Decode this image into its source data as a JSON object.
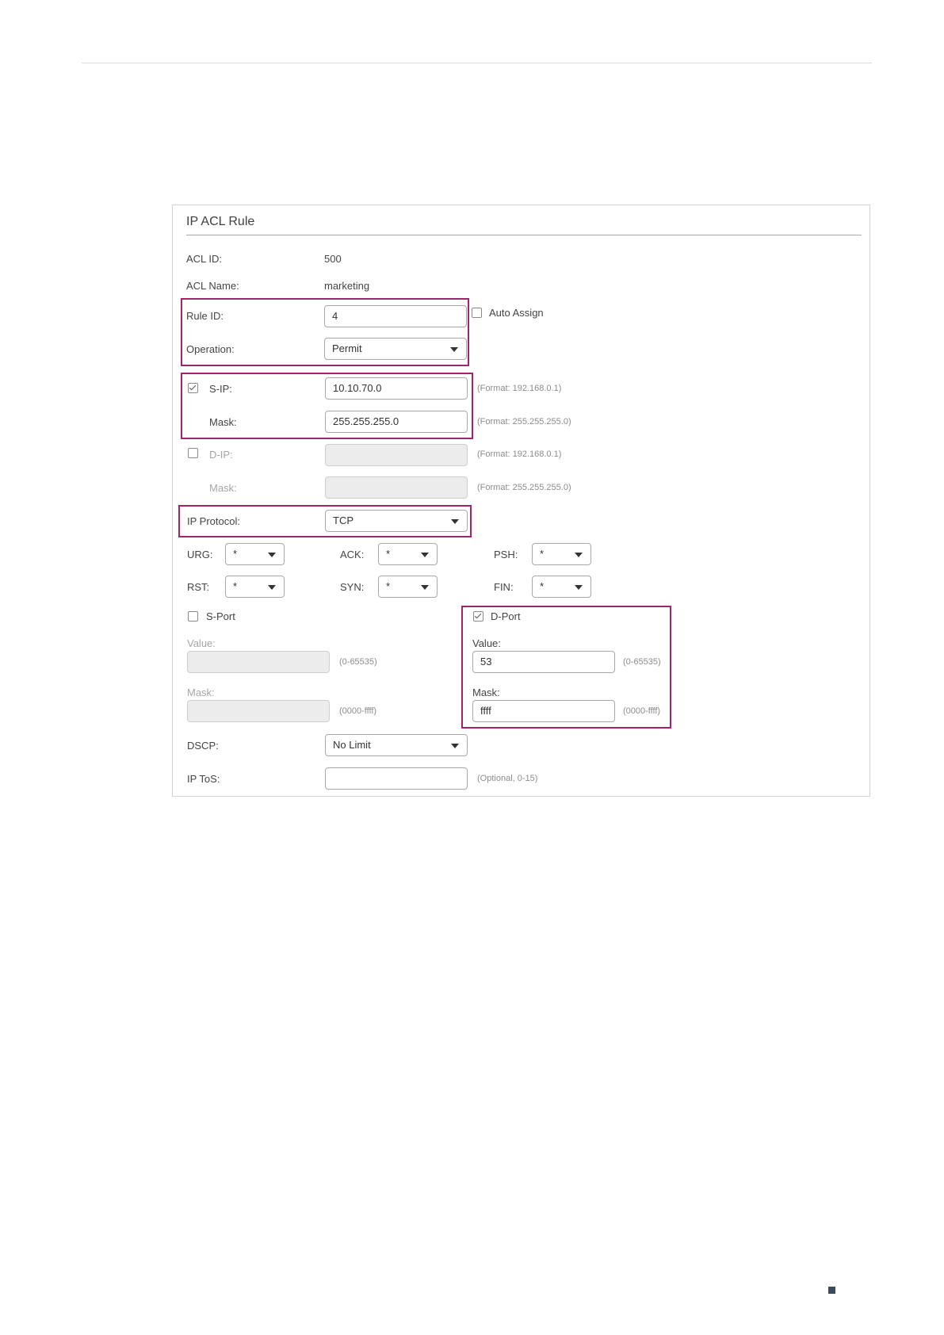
{
  "panel": {
    "title": "IP ACL Rule"
  },
  "acl": {
    "id_label": "ACL ID:",
    "id_value": "500",
    "name_label": "ACL Name:",
    "name_value": "marketing"
  },
  "rule_id": {
    "label": "Rule ID:",
    "value": "4",
    "auto_assign_label": "Auto Assign",
    "auto_assign_checked": false
  },
  "operation": {
    "label": "Operation:",
    "value": "Permit"
  },
  "sip": {
    "label": "S-IP:",
    "checked": true,
    "value": "10.10.70.0",
    "hint": "(Format: 192.168.0.1)",
    "mask_label": "Mask:",
    "mask_value": "255.255.255.0",
    "mask_hint": "(Format: 255.255.255.0)"
  },
  "dip": {
    "label": "D-IP:",
    "checked": false,
    "value": "",
    "hint": "(Format: 192.168.0.1)",
    "mask_label": "Mask:",
    "mask_value": "",
    "mask_hint": "(Format: 255.255.255.0)"
  },
  "ip_protocol": {
    "label": "IP Protocol:",
    "value": "TCP"
  },
  "flags": {
    "urg": {
      "label": "URG:",
      "value": "*"
    },
    "ack": {
      "label": "ACK:",
      "value": "*"
    },
    "psh": {
      "label": "PSH:",
      "value": "*"
    },
    "rst": {
      "label": "RST:",
      "value": "*"
    },
    "syn": {
      "label": "SYN:",
      "value": "*"
    },
    "fin": {
      "label": "FIN:",
      "value": "*"
    }
  },
  "sport": {
    "label": "S-Port",
    "checked": false,
    "value_label": "Value:",
    "value": "",
    "value_hint": "(0-65535)",
    "mask_label": "Mask:",
    "mask": "",
    "mask_hint": "(0000-ffff)"
  },
  "dport": {
    "label": "D-Port",
    "checked": true,
    "value_label": "Value:",
    "value": "53",
    "value_hint": "(0-65535)",
    "mask_label": "Mask:",
    "mask": "ffff",
    "mask_hint": "(0000-ffff)"
  },
  "dscp": {
    "label": "DSCP:",
    "value": "No Limit"
  },
  "ip_tos": {
    "label": "IP ToS:",
    "value": "",
    "hint": "(Optional, 0-15)"
  },
  "colors": {
    "highlight": "#a1256b",
    "page_marker": "#3b4a5c"
  }
}
